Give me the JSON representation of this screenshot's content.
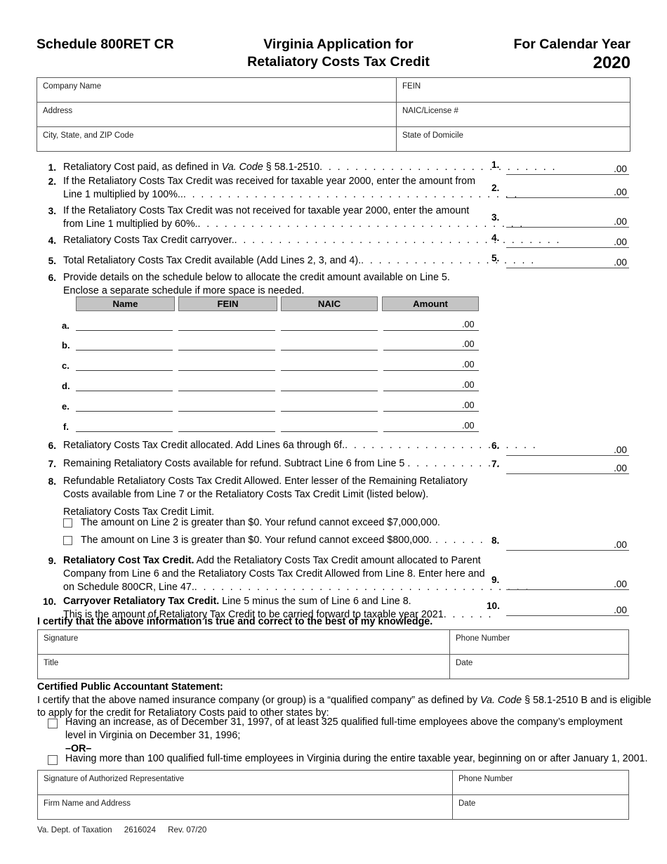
{
  "header": {
    "schedule": "Schedule 800RET CR",
    "title_line1": "Virginia Application for",
    "title_line2": "Retaliatory Costs Tax Credit",
    "calendar_label": "For Calendar Year",
    "year": "2020"
  },
  "company_table": {
    "rows": [
      {
        "left": "Company Name",
        "right": "FEIN"
      },
      {
        "left": "Address",
        "right": "NAIC/License #"
      },
      {
        "left": "City, State, and ZIP Code",
        "right": "State of Domicile"
      }
    ]
  },
  "lines": {
    "l1": {
      "num": "1.",
      "t1": "Retaliatory Cost paid, as defined in ",
      "t2": "Va. Code",
      "t3": " § 58.1-2510",
      "dots": ". . . . . . . . . . . . . . . . . . . . . . . . . . ."
    },
    "l2": {
      "num": "2.",
      "row1": "If the Retaliatory Costs Tax Credit was received for taxable year 2000, enter the amount from",
      "row2": "Line 1 multiplied by 100%..",
      "dots": ". . . . . . . . . . . . . . . . . . . . . . . . . . . . . . . . . . . . . ."
    },
    "l3": {
      "num": "3.",
      "row1": "If the Retaliatory Costs Tax Credit was not received for taxable year 2000, enter the amount",
      "row2": "from Line 1 multiplied by 60%.",
      "dots": ". . . . . . . . . . . . . . . . . . . . . . . . . . . . . . . . . . . . ."
    },
    "l4": {
      "num": "4.",
      "row1": "Retaliatory Costs Tax Credit carryover.",
      "dots": ". . . . . . . . . . . . . . . . . . . . . . . . . . . . . . . . . . . . ."
    },
    "l5": {
      "num": "5.",
      "row1": "Total Retaliatory Costs Tax Credit available (Add Lines 2, 3, and 4).",
      "dots": ". . . . . . . . . . . . . . . . . . . ."
    },
    "l6_intro": {
      "num": "6.",
      "row1": "Provide details on the schedule below to allocate the credit amount available on Line 5.",
      "row2": "Enclose a separate schedule if more space is needed."
    },
    "l6": {
      "num": "6.",
      "row1": "Retaliatory Costs Tax Credit allocated. Add Lines 6a through 6f.",
      "dots": ". . . . . . . . . . . . . . . . . . . . . ."
    },
    "l7": {
      "num": "7.",
      "row1": "Remaining Retaliatory Costs available for refund. Subtract Line 6 from Line 5 ",
      "dots": ". . . . . . . . . . ."
    },
    "l8": {
      "num": "8.",
      "row1": "Refundable Retaliatory Costs Tax Credit Allowed. Enter lesser of the Remaining Retaliatory",
      "row2": "Costs available from Line 7 or the Retaliatory Costs Tax Credit Limit (listed below).",
      "limit_label": "Retaliatory Costs Tax Credit Limit.",
      "cb1": "The amount on Line 2 is greater than $0. Your refund cannot exceed $7,000,000.",
      "cb2": "The amount on Line 3 is greater than $0. Your refund cannot exceed $800,000.",
      "cb2_dots": ". . . . . ."
    },
    "l9": {
      "num": "9.",
      "bold": "Retaliatory Cost Tax Credit.",
      "row1": " Add the Retaliatory Costs Tax Credit amount allocated to Parent",
      "row2": "Company from Line 6 and the Retaliatory Costs Tax Credit Allowed from Line 8. Enter here and",
      "row3": "on Schedule 800CR, Line 47.",
      "dots": ". . . . . . . . . . . . . . . . . . . . . . . . . . . . . . . . . . . . . ."
    },
    "l10": {
      "num": "10.",
      "bold": "Carryover Retaliatory Tax Credit.",
      "row1": " Line 5 minus the sum of Line 6 and Line 8.",
      "row2": "This is the amount of Retaliatory Tax Credit to be carried forward to taxable year 2021",
      "dots": ". . . . . ."
    }
  },
  "amounts": {
    "cents": ".00",
    "fields": [
      {
        "num": "1."
      },
      {
        "num": "2."
      },
      {
        "num": "3."
      },
      {
        "num": "4."
      },
      {
        "num": "5."
      },
      {
        "num": "6."
      },
      {
        "num": "7."
      },
      {
        "num": "8."
      },
      {
        "num": "9."
      },
      {
        "num": "10."
      }
    ]
  },
  "schedule": {
    "columns": [
      "Name",
      "FEIN",
      "NAIC",
      "Amount"
    ],
    "row_labels": [
      "a.",
      "b.",
      "c.",
      "d.",
      "e.",
      "f."
    ],
    "cents": ".00"
  },
  "certify": {
    "statement": "I certify that the above information is true and correct to the best of my knowledge."
  },
  "signature_table": {
    "rows": [
      {
        "left": "Signature",
        "right": "Phone Number"
      },
      {
        "left": "Title",
        "right": "Date"
      }
    ]
  },
  "cpa": {
    "heading": "Certified Public Accountant Statement:",
    "body1a": "I certify that the above named insurance company (or group) is a “qualified company” as defined by ",
    "body1b": "Va. Code",
    "body1c": " § 58.1-2510 B and is eligible",
    "body2": "to apply for the credit for Retaliatory Costs paid to other states by:",
    "cb1_line1": "Having an increase, as of December 31, 1997, of at least 325 qualified full-time employees above the company’s employment",
    "cb1_line2": "level in Virginia on December 31, 1996;",
    "or_label": "–OR–",
    "cb2_line1": "Having more than 100 qualified full-time employees in Virginia during the entire taxable year, beginning on or after January 1, 2001."
  },
  "authorized_table": {
    "rows": [
      {
        "left": "Signature of Authorized Representative",
        "right": "Phone Number"
      },
      {
        "left": "Firm Name and Address",
        "right": "Date"
      }
    ]
  },
  "footer": {
    "agency": "Va. Dept. of Taxation",
    "form_number": "2616024",
    "revision": "Rev. 07/20"
  }
}
